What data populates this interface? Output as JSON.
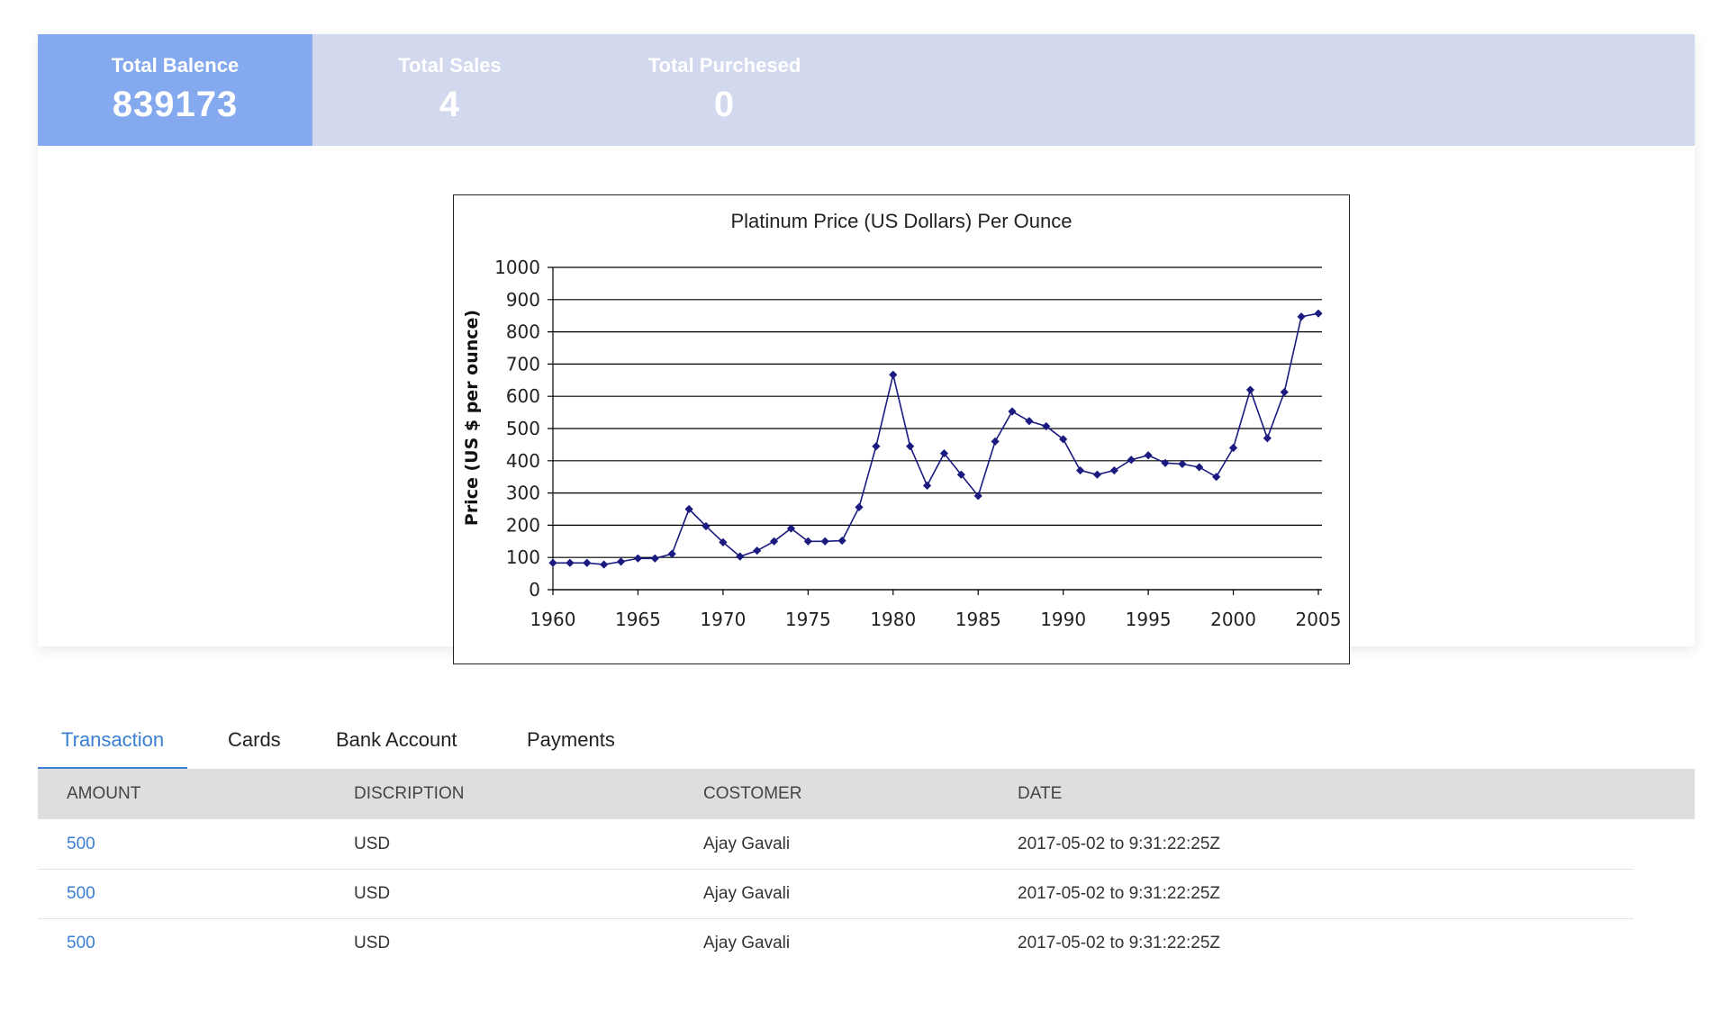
{
  "stats": [
    {
      "label": "Total Balence",
      "value": "839173",
      "active": true
    },
    {
      "label": "Total Sales",
      "value": "4",
      "active": false
    },
    {
      "label": "Total Purchesed",
      "value": "0",
      "active": false
    }
  ],
  "colors": {
    "stat_active": "#84a9ee",
    "stat_bar": "#d2d8ed",
    "accent": "#3b7fd4",
    "series": "#1a1a80",
    "table_header": "#dedede"
  },
  "chart_data": {
    "type": "line",
    "title": "Platinum Price (US Dollars) Per Ounce",
    "xlabel": "",
    "ylabel": "Price (US $ per ounce)",
    "xlim": [
      1960,
      2005
    ],
    "ylim": [
      0,
      1000
    ],
    "xticks": [
      1960,
      1965,
      1970,
      1975,
      1980,
      1985,
      1990,
      1995,
      2000,
      2005
    ],
    "yticks": [
      0,
      100,
      200,
      300,
      400,
      500,
      600,
      700,
      800,
      900,
      1000
    ],
    "grid": "horizontal",
    "legend": "none",
    "series": [
      {
        "x": [
          1960,
          1961,
          1962,
          1963,
          1964,
          1965,
          1966,
          1967,
          1968,
          1969,
          1970,
          1971,
          1972,
          1973,
          1974,
          1975,
          1976,
          1977,
          1978,
          1979,
          1980,
          1981,
          1982,
          1983,
          1984,
          1985,
          1986,
          1987,
          1988,
          1989,
          1990,
          1991,
          1992,
          1993,
          1994,
          1995,
          1996,
          1997,
          1998,
          1999,
          2000,
          2001,
          2002,
          2003,
          2004,
          2005
        ],
        "y": [
          83,
          83,
          83,
          78,
          87,
          97,
          97,
          111,
          250,
          197,
          147,
          103,
          121,
          150,
          190,
          150,
          150,
          152,
          256,
          445,
          667,
          445,
          323,
          423,
          357,
          291,
          460,
          553,
          523,
          507,
          467,
          370,
          357,
          370,
          403,
          417,
          393,
          390,
          380,
          350,
          440,
          620,
          470,
          613,
          847,
          857
        ]
      }
    ]
  },
  "tabs": [
    "Transaction",
    "Cards",
    "Bank Account",
    "Payments"
  ],
  "table": {
    "headers": [
      "AMOUNT",
      "DISCRIPTION",
      "COSTOMER",
      "DATE"
    ],
    "rows": [
      [
        "500",
        "USD",
        "Ajay Gavali",
        "2017-05-02 to 9:31:22:25Z"
      ],
      [
        "500",
        "USD",
        "Ajay Gavali",
        "2017-05-02 to 9:31:22:25Z"
      ],
      [
        "500",
        "USD",
        "Ajay Gavali",
        "2017-05-02 to 9:31:22:25Z"
      ]
    ]
  }
}
